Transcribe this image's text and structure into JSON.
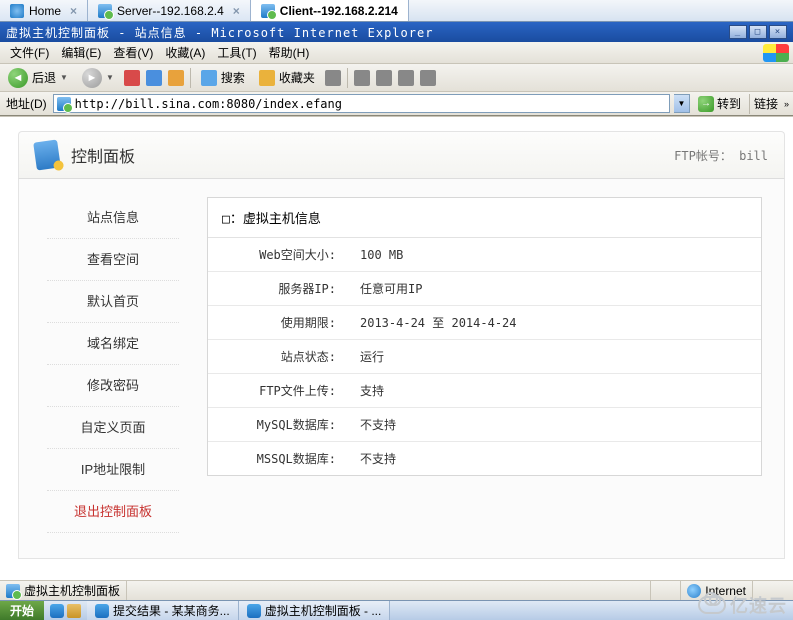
{
  "systabs": [
    {
      "label": "Home",
      "active": false
    },
    {
      "label": "Server--192.168.2.4",
      "active": false
    },
    {
      "label": "Client--192.168.2.214",
      "active": true
    }
  ],
  "window_title": "虚拟主机控制面板 - 站点信息 - Microsoft Internet Explorer",
  "menubar": {
    "file": "文件(F)",
    "edit": "编辑(E)",
    "view": "查看(V)",
    "favorites": "收藏(A)",
    "tools": "工具(T)",
    "help": "帮助(H)"
  },
  "toolbar": {
    "back": "后退",
    "search": "搜索",
    "favorites": "收藏夹"
  },
  "addressbar": {
    "label": "地址(D)",
    "url": "http://bill.sina.com:8080/index.efang",
    "go": "转到",
    "links": "链接"
  },
  "panel": {
    "title": "控制面板",
    "account_label": "FTP帐号：",
    "account_value": "bill"
  },
  "sidemenu": {
    "site_info": "站点信息",
    "view_space": "查看空间",
    "default_page": "默认首页",
    "domain_bind": "域名绑定",
    "change_pwd": "修改密码",
    "custom_page": "自定义页面",
    "ip_limit": "IP地址限制",
    "exit": "退出控制面板"
  },
  "infobox": {
    "caption": "□：虚拟主机信息",
    "rows": {
      "web_space_k": "Web空间大小:",
      "web_space_v": "100 MB",
      "server_ip_k": "服务器IP:",
      "server_ip_v": "任意可用IP",
      "period_k": "使用期限:",
      "period_v": "2013-4-24 至 2014-4-24",
      "status_k": "站点状态:",
      "status_v": "运行",
      "ftp_k": "FTP文件上传:",
      "ftp_v": "支持",
      "mysql_k": "MySQL数据库:",
      "mysql_v": "不支持",
      "mssql_k": "MSSQL数据库:",
      "mssql_v": "不支持"
    }
  },
  "statusbar": {
    "page_title": "虚拟主机控制面板",
    "zone": "Internet"
  },
  "taskbar": {
    "start": "开始",
    "items": [
      "提交结果 - 某某商务...",
      "虚拟主机控制面板 - ..."
    ]
  },
  "watermark": "亿速云"
}
